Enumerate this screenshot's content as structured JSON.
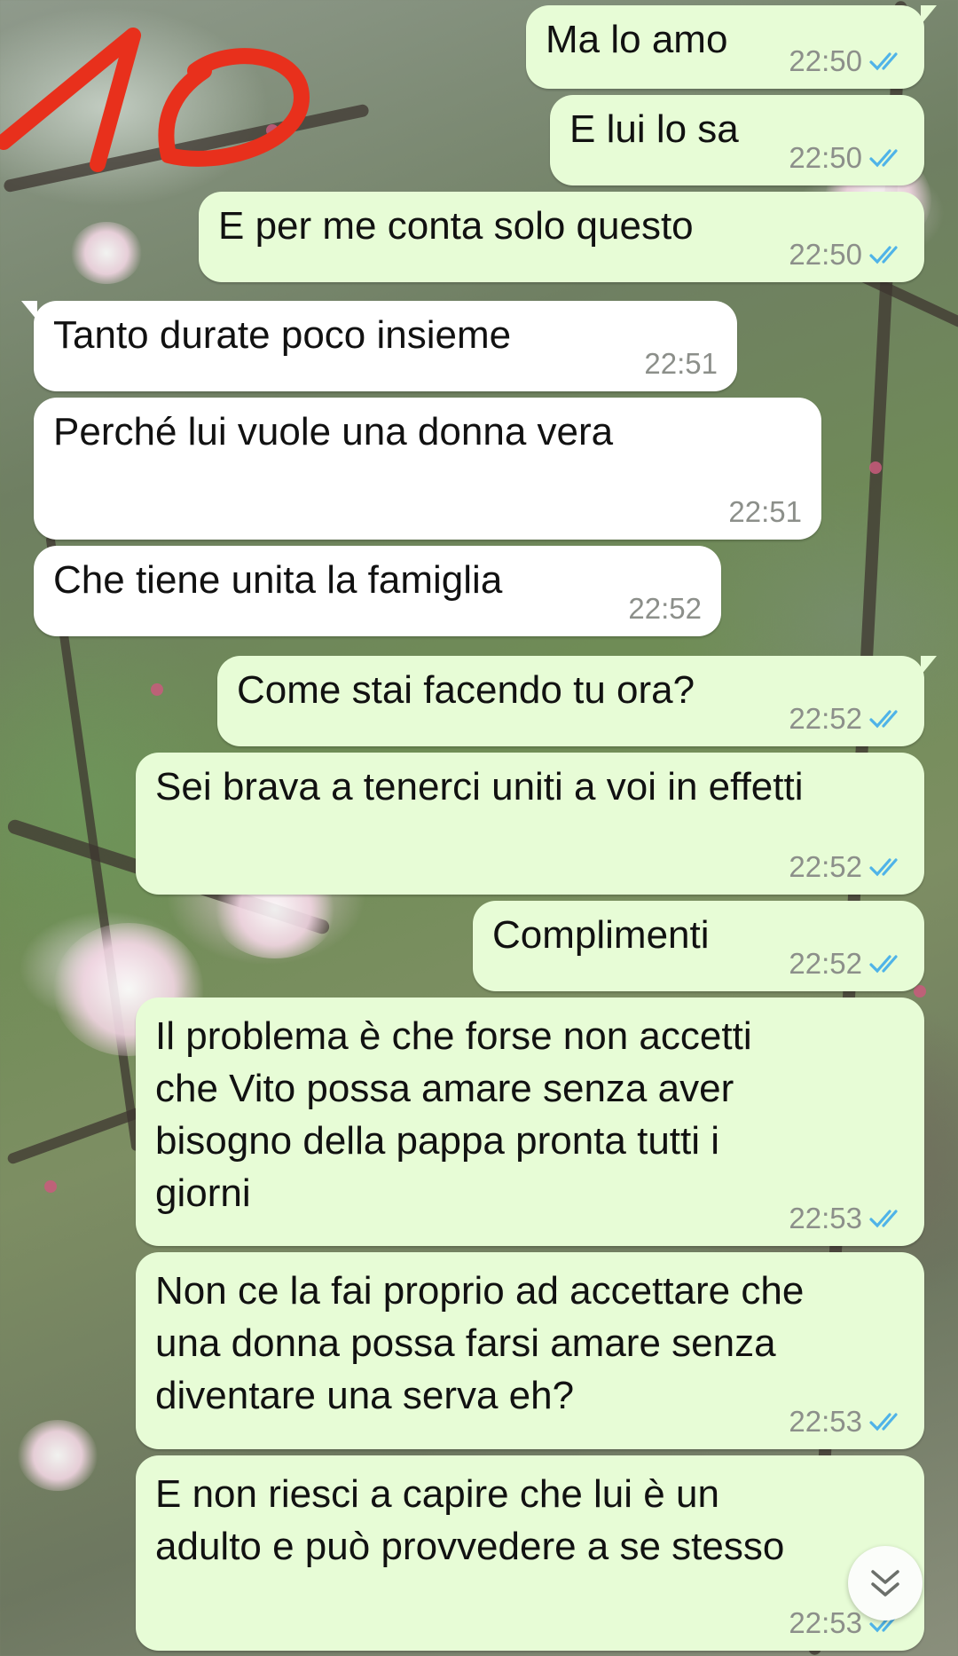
{
  "colors": {
    "outgoing_bubble": "#e7fcd6",
    "incoming_bubble": "#ffffff",
    "read_ticks": "#4fb3e8",
    "handwritten_mark": "#e8301c"
  },
  "handwritten_mark_text": "10",
  "messages": [
    {
      "direction": "outgoing",
      "text": "Ma lo amo",
      "time": "22:50",
      "status": "read"
    },
    {
      "direction": "outgoing",
      "text": "E lui lo sa",
      "time": "22:50",
      "status": "read"
    },
    {
      "direction": "outgoing",
      "text": "E per me conta solo questo",
      "time": "22:50",
      "status": "read"
    },
    {
      "direction": "incoming",
      "text": "Tanto durate poco insieme",
      "time": "22:51"
    },
    {
      "direction": "incoming",
      "text": "Perché lui vuole una donna vera",
      "time": "22:51"
    },
    {
      "direction": "incoming",
      "text": "Che tiene unita la famiglia",
      "time": "22:52"
    },
    {
      "direction": "outgoing",
      "text": "Come stai facendo tu ora?",
      "time": "22:52",
      "status": "read"
    },
    {
      "direction": "outgoing",
      "text": "Sei brava a tenerci uniti a voi in effetti",
      "time": "22:52",
      "status": "read"
    },
    {
      "direction": "outgoing",
      "text": "Complimenti",
      "time": "22:52",
      "status": "read"
    },
    {
      "direction": "outgoing",
      "text": "Il problema è che forse non accetti\nche Vito possa amare senza aver\nbisogno della pappa pronta tutti i\ngiorni",
      "time": "22:53",
      "status": "read"
    },
    {
      "direction": "outgoing",
      "text": "Non ce la fai proprio ad accettare che\nuna donna possa farsi amare senza\ndiventare una serva eh?",
      "time": "22:53",
      "status": "read"
    },
    {
      "direction": "outgoing",
      "text": "E non riesci a capire che lui è un\nadulto e può provvedere a se stesso",
      "time": "22:53",
      "status": "read"
    }
  ],
  "icons": {
    "read_receipt": "double-check-icon",
    "scroll_down": "chevron-double-down-icon"
  }
}
